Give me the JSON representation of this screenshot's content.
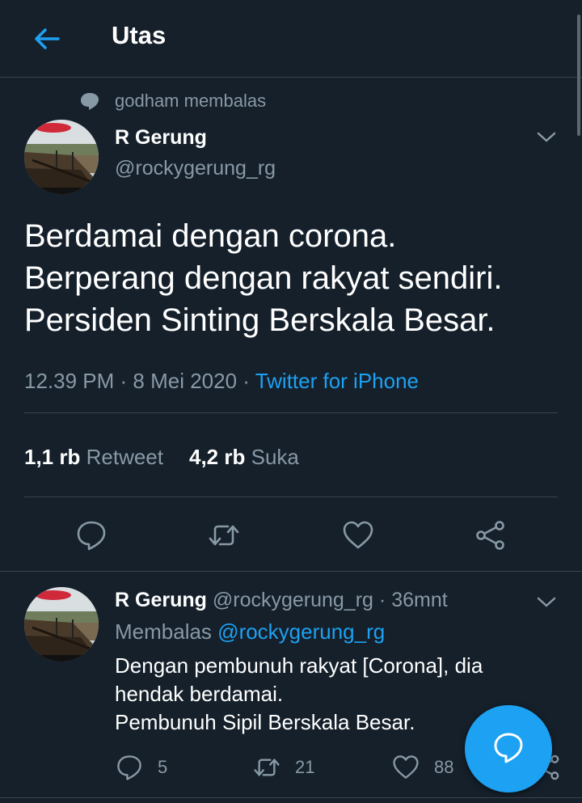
{
  "header": {
    "title": "Utas"
  },
  "context": {
    "text": "godham membalas"
  },
  "tweet": {
    "name": "R Gerung",
    "handle": "@rockygerung_rg",
    "lines": [
      "Berdamai dengan corona.",
      "Berperang dengan rakyat sendiri.",
      "Persiden Sinting Berskala Besar."
    ],
    "time": "12.39 PM",
    "date": "8 Mei 2020",
    "source": "Twitter for iPhone",
    "retweet_count": "1,1 rb",
    "retweet_label": "Retweet",
    "like_count": "4,2 rb",
    "like_label": "Suka"
  },
  "reply": {
    "name": "R Gerung",
    "handle": "@rockygerung_rg",
    "age": "36mnt",
    "replying_label": "Membalas",
    "replying_to": "@rockygerung_rg",
    "lines": [
      "Dengan pembunuh rakyat [Corona], dia",
      "hendak berdamai.",
      "Pembunuh Sipil Berskala Besar."
    ],
    "reply_count": "5",
    "retweet_count": "21",
    "like_count": "88"
  },
  "colors": {
    "background": "#15202b",
    "accent": "#1da1f2",
    "muted": "#8899a6",
    "divider": "#38444d"
  },
  "icons": [
    "back-arrow-icon",
    "speech-bubble-icon",
    "chevron-down-icon",
    "reply-icon",
    "retweet-icon",
    "heart-icon",
    "share-icon",
    "compose-icon"
  ]
}
